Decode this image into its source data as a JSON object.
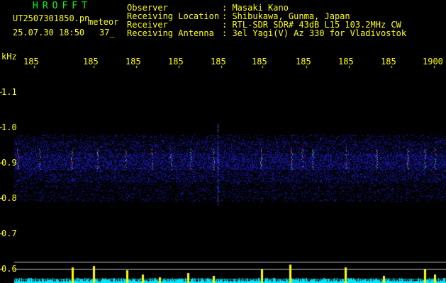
{
  "header": {
    "brand": "HROFFT",
    "filename": "UT2507301850.pn",
    "mode": "meteor",
    "datetime": "25.07.30 18:50",
    "count": "37_",
    "info_labels": [
      "Observer",
      "Receiving Location",
      "Receiver",
      "Receiving Antenna"
    ],
    "info_values": [
      ": Masaki Kano",
      ": Shibukawa, Gunma, Japan",
      ": RTL-SDR SDR# 43dB L15 103.2MHz CW",
      ": 3el Yagi(V) Az 330 for Vladivostok"
    ]
  },
  "axes": {
    "y_unit": "kHz",
    "y_ticks": [
      "1.1",
      "1.0",
      "0.9",
      "0.8",
      "0.7",
      "0.6"
    ],
    "x_ticks": [
      "185",
      "185",
      "185",
      "185",
      "185",
      "185",
      "185",
      "185",
      "185",
      "1900"
    ]
  },
  "colors": {
    "text": "#ffff00",
    "brand": "#00ff00",
    "noise": "#1a1a8c",
    "echo_hot": "#ff2020",
    "echo_mid": "#00ff80",
    "spectrum_fill": "#00e5ff",
    "spectrum_peak": "#ffff00",
    "grid": "#ffffff"
  }
}
